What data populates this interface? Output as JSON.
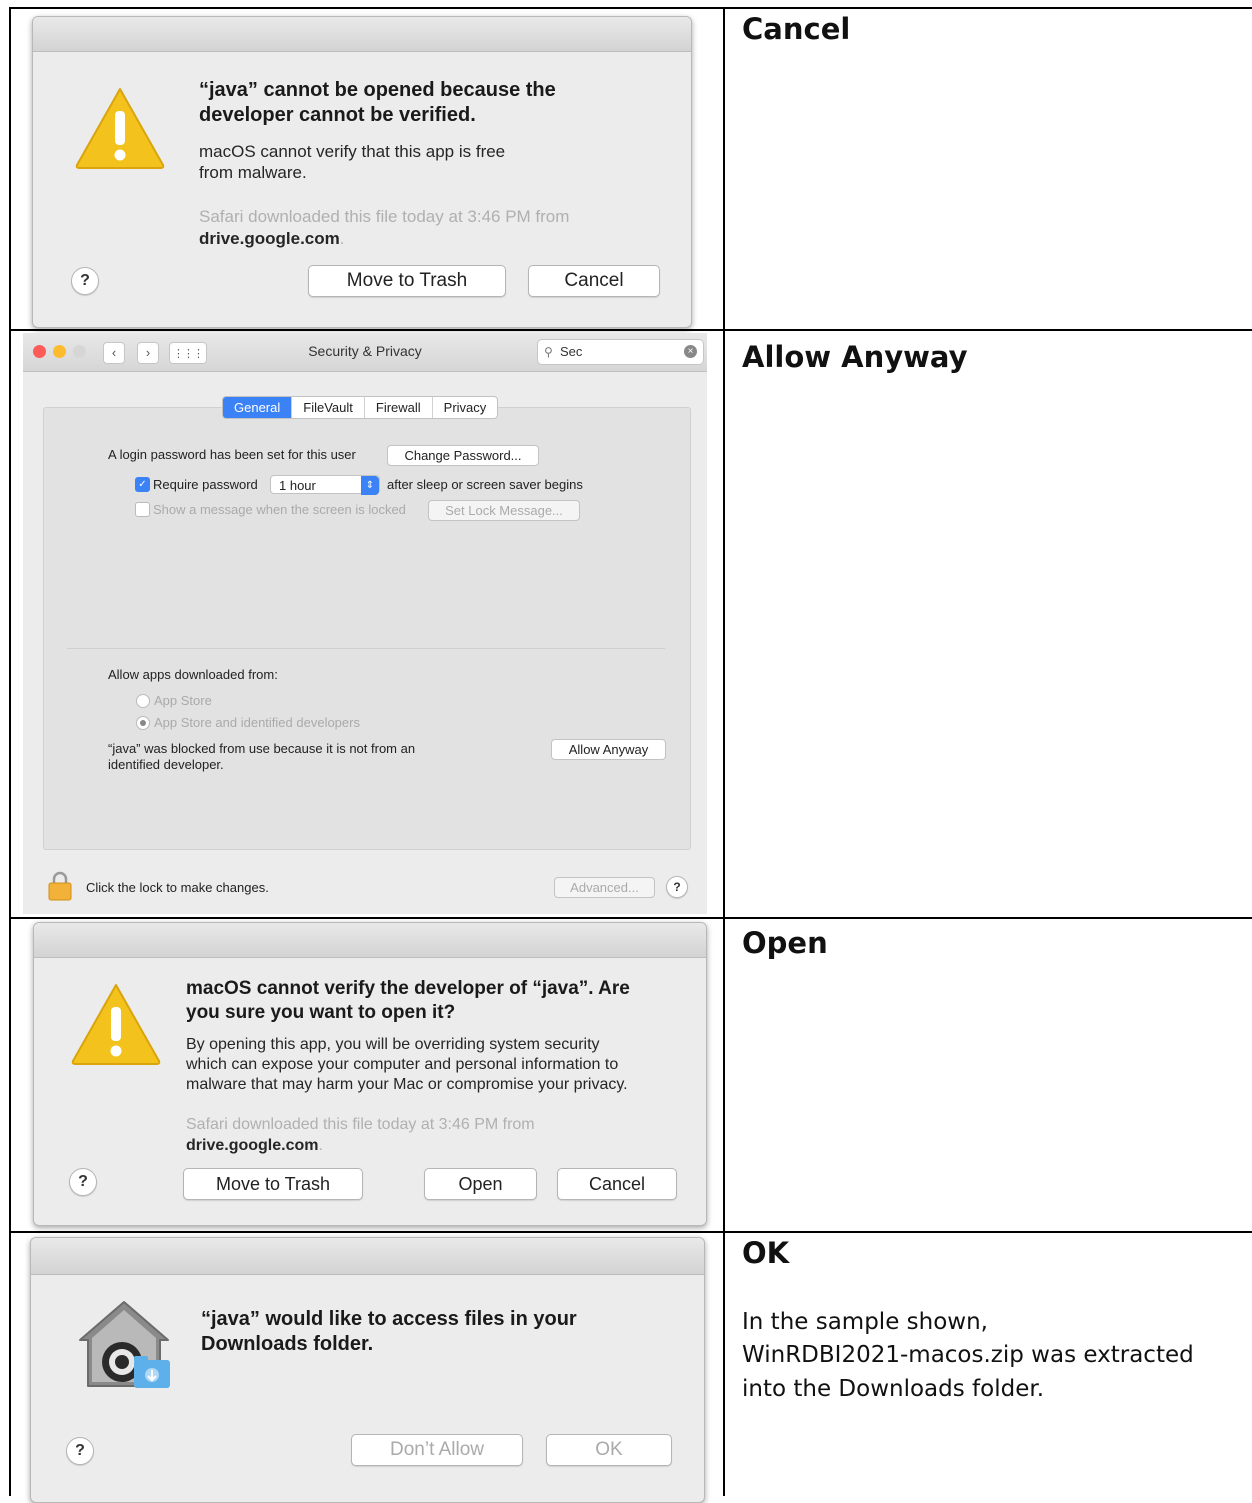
{
  "rows": [
    {
      "action": "Cancel",
      "dialog": {
        "title_line1": "“java” cannot be opened because the",
        "title_line2": "developer cannot be verified.",
        "body_line1": "macOS cannot verify that this app is free",
        "body_line2": "from malware.",
        "source_line1": "Safari downloaded this file today at 3:46 PM from",
        "source_domain": "drive.google.com",
        "source_end": ".",
        "help": "?",
        "button_trash": "Move to Trash",
        "button_cancel": "Cancel",
        "icon": "warning-icon"
      }
    },
    {
      "action": "Allow Anyway",
      "window": {
        "title": "Security & Privacy",
        "search_value": "Sec",
        "tabs": [
          "General",
          "FileVault",
          "Firewall",
          "Privacy"
        ],
        "active_tab": "General",
        "login_password_label": "A login password has been set for this user",
        "change_password_button": "Change Password...",
        "require_password_label": "Require password",
        "require_password_value": "1 hour",
        "after_sleep_label": "after sleep or screen saver begins",
        "show_message_label": "Show a message when the screen is locked",
        "set_lock_message_button": "Set Lock Message...",
        "allow_apps_label": "Allow apps downloaded from:",
        "radio_app_store": "App Store",
        "radio_identified": "App Store and identified developers",
        "blocked_line1": "“java” was blocked from use because it is not from an",
        "blocked_line2": "identified developer.",
        "allow_anyway_button": "Allow Anyway",
        "lock_text": "Click the lock to make changes.",
        "advanced_button": "Advanced...",
        "help": "?",
        "accent_color": "#3b82f6"
      }
    },
    {
      "action": "Open",
      "dialog": {
        "title_line1": "macOS cannot verify the developer of “java”. Are",
        "title_line2": "you sure you want to open it?",
        "body_line1": "By opening this app, you will be overriding system security",
        "body_line2": "which can expose your computer and personal information to",
        "body_line3": "malware that may harm your Mac or compromise your privacy.",
        "source_line1": "Safari downloaded this file today at 3:46 PM from",
        "source_domain": "drive.google.com",
        "source_end": ".",
        "help": "?",
        "button_trash": "Move to Trash",
        "button_open": "Open",
        "button_cancel": "Cancel",
        "icon": "warning-icon"
      }
    },
    {
      "action": "OK",
      "note_line1": "In the sample shown,",
      "note_line2": "WinRDBI2021-macos.zip was extracted",
      "note_line3": "into the Downloads folder.",
      "dialog": {
        "title_line1": "“java” would like to access files in your",
        "title_line2": "Downloads folder.",
        "help": "?",
        "button_dont_allow": "Don’t Allow",
        "button_ok": "OK",
        "icon": "security-folder-icon"
      }
    }
  ]
}
